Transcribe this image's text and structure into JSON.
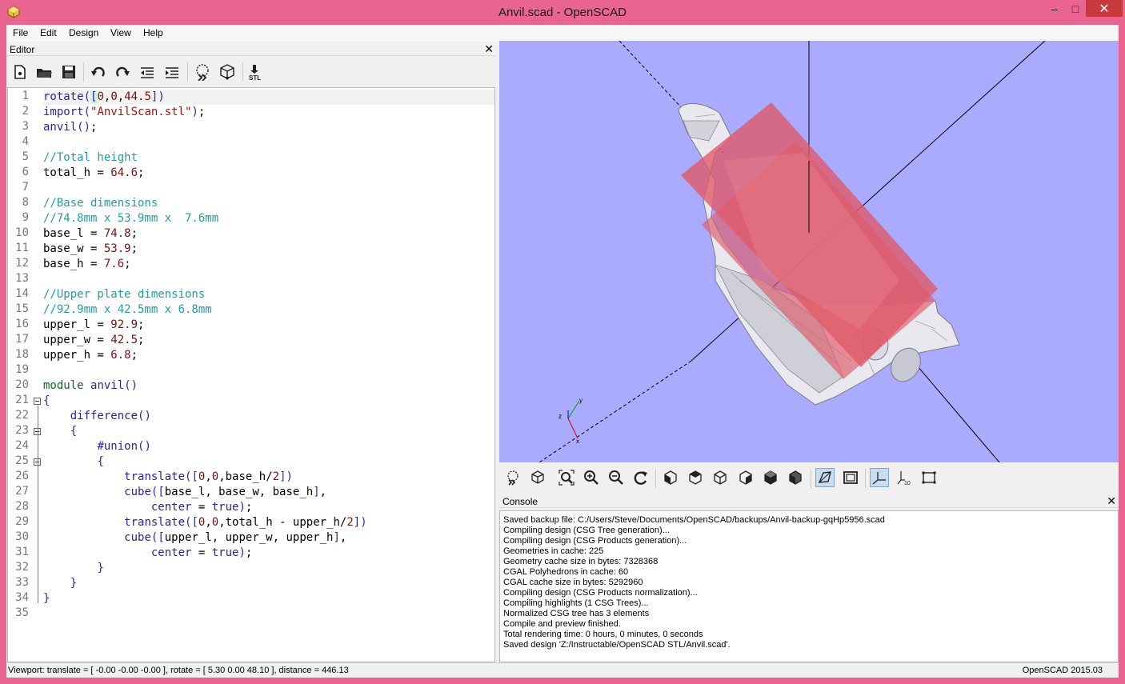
{
  "window": {
    "title": "Anvil.scad - OpenSCAD",
    "minimize_glyph": "–",
    "maximize_glyph": "□",
    "close_glyph": "✕"
  },
  "menu": [
    "File",
    "Edit",
    "Design",
    "View",
    "Help"
  ],
  "editor": {
    "panel_title": "Editor",
    "close_glyph": "✕",
    "toolbar": {
      "stl_label": "STL"
    }
  },
  "code_lines": [
    "rotate([0,0,44.5])",
    "import(\"AnvilScan.stl\");",
    "anvil();",
    "",
    "//Total height",
    "total_h = 64.6;",
    "",
    "//Base dimensions",
    "//74.8mm x 53.9mm x  7.6mm",
    "base_l = 74.8;",
    "base_w = 53.9;",
    "base_h = 7.6;",
    "",
    "//Upper plate dimensions",
    "//92.9mm x 42.5mm x 6.8mm",
    "upper_l = 92.9;",
    "upper_w = 42.5;",
    "upper_h = 6.8;",
    "",
    "module anvil()",
    "{",
    "    difference()",
    "    {",
    "        #union()",
    "        {",
    "            translate([0,0,base_h/2])",
    "            cube([base_l, base_w, base_h],",
    "                center = true);",
    "            translate([0,0,total_h - upper_h/2])",
    "            cube([upper_l, upper_w, upper_h],",
    "                center = true);",
    "        }",
    "    }",
    "}",
    ""
  ],
  "viewport": {
    "background": "#aaaaff",
    "axes_label_x": "x",
    "axes_label_y": "y",
    "axes_label_z": "z",
    "model_color": "#e8e8ee",
    "highlight_color": "#e05a6a"
  },
  "console": {
    "panel_title": "Console",
    "close_glyph": "✕",
    "lines": [
      "Saved backup file: C:/Users/Steve/Documents/OpenSCAD/backups/Anvil-backup-gqHp5956.scad",
      "Compiling design (CSG Tree generation)...",
      "Compiling design (CSG Products generation)...",
      "Geometries in cache: 225",
      "Geometry cache size in bytes: 7328368",
      "CGAL Polyhedrons in cache: 60",
      "CGAL cache size in bytes: 5292960",
      "Compiling design (CSG Products normalization)...",
      "Compiling highlights (1 CSG Trees)...",
      "Normalized CSG tree has 3 elements",
      "Compile and preview finished.",
      "Total rendering time: 0 hours, 0 minutes, 0 seconds",
      "Saved design 'Z:/Instructable/OpenSCAD STL/Anvil.scad'."
    ]
  },
  "view_toolbar": {
    "scale_label": "10"
  },
  "status": {
    "viewport": "Viewport: translate = [ -0.00 -0.00 -0.00 ], rotate = [ 5.30 0.00 48.10 ], distance = 446.13",
    "version": "OpenSCAD 2015.03"
  },
  "colors": {
    "titlebar": "#e9658f",
    "close_button": "#c7393d",
    "comment": "#249ba3",
    "keyword": "#26269d",
    "module": "#0c6d1d",
    "string": "#a01515",
    "number": "#7b1010"
  }
}
